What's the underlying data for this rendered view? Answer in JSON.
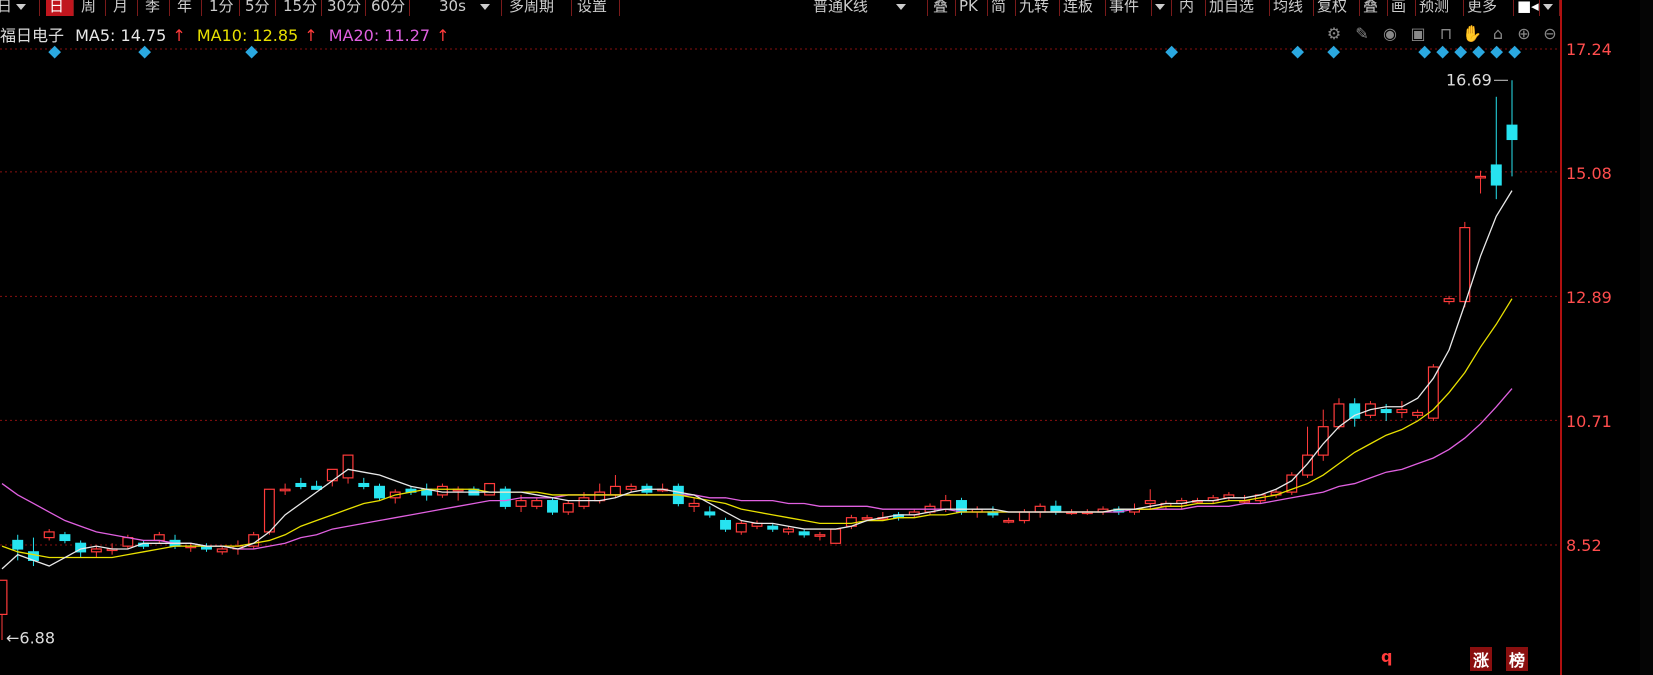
{
  "toolbar": {
    "left_clip": "日",
    "periods": [
      "日",
      "周",
      "月",
      "季",
      "年",
      "1分",
      "5分",
      "15分",
      "30分",
      "60分",
      "30s"
    ],
    "multi": "多周期",
    "settings": "设置",
    "kline_type": "普通K线",
    "right_items": [
      "叠",
      "PK",
      "简",
      "九转",
      "连板",
      "事件",
      "内",
      "加自选",
      "均线",
      "复权",
      "叠",
      "画",
      "预测",
      "更多"
    ]
  },
  "header": {
    "stock_name": "福日电子",
    "ma5": "MA5: 14.75",
    "ma10": "MA10: 12.85",
    "ma20": "MA20: 11.27",
    "arrow": "↑"
  },
  "colors": {
    "up": "#ff3b3b",
    "down": "#27e3f0",
    "ma5": "#e8e8e8",
    "ma10": "#e8e000",
    "ma20": "#e060e0",
    "grid": "#8a1010",
    "event_marker": "#2aa8e0"
  },
  "price_axis": {
    "labels": [
      "17.24",
      "15.08",
      "12.89",
      "10.71",
      "8.52"
    ]
  },
  "annotations": {
    "high": "16.69",
    "low": "6.88"
  },
  "bottom_badges": [
    "q",
    "涨",
    "榜"
  ],
  "chart_data": {
    "type": "candlestick",
    "ylim": [
      6.4,
      18.0
    ],
    "y_ticks": [
      17.24,
      15.08,
      12.89,
      10.71,
      8.52
    ],
    "ohlc": [
      [
        7.3,
        7.9,
        6.85,
        7.9
      ],
      [
        8.6,
        8.7,
        8.25,
        8.45
      ],
      [
        8.4,
        8.65,
        8.15,
        8.25
      ],
      [
        8.65,
        8.8,
        8.6,
        8.75
      ],
      [
        8.7,
        8.75,
        8.55,
        8.6
      ],
      [
        8.55,
        8.6,
        8.3,
        8.4
      ],
      [
        8.4,
        8.5,
        8.3,
        8.45
      ],
      [
        8.45,
        8.55,
        8.35,
        8.45
      ],
      [
        8.5,
        8.7,
        8.45,
        8.65
      ],
      [
        8.55,
        8.6,
        8.45,
        8.5
      ],
      [
        8.6,
        8.75,
        8.55,
        8.7
      ],
      [
        8.6,
        8.7,
        8.45,
        8.5
      ],
      [
        8.5,
        8.55,
        8.4,
        8.5
      ],
      [
        8.5,
        8.55,
        8.4,
        8.45
      ],
      [
        8.4,
        8.5,
        8.35,
        8.45
      ],
      [
        8.45,
        8.6,
        8.35,
        8.5
      ],
      [
        8.5,
        8.75,
        8.45,
        8.7
      ],
      [
        8.75,
        9.5,
        8.7,
        9.5
      ],
      [
        9.5,
        9.6,
        9.4,
        9.5
      ],
      [
        9.6,
        9.7,
        9.5,
        9.55
      ],
      [
        9.55,
        9.65,
        9.5,
        9.5
      ],
      [
        9.65,
        9.85,
        9.55,
        9.85
      ],
      [
        9.7,
        10.1,
        9.6,
        10.1
      ],
      [
        9.6,
        9.7,
        9.5,
        9.55
      ],
      [
        9.55,
        9.6,
        9.3,
        9.35
      ],
      [
        9.35,
        9.5,
        9.25,
        9.45
      ],
      [
        9.5,
        9.55,
        9.4,
        9.45
      ],
      [
        9.5,
        9.6,
        9.3,
        9.4
      ],
      [
        9.4,
        9.6,
        9.35,
        9.55
      ],
      [
        9.5,
        9.55,
        9.3,
        9.5
      ],
      [
        9.5,
        9.55,
        9.4,
        9.4
      ],
      [
        9.4,
        9.6,
        9.4,
        9.6
      ],
      [
        9.5,
        9.55,
        9.15,
        9.2
      ],
      [
        9.2,
        9.4,
        9.1,
        9.3
      ],
      [
        9.2,
        9.35,
        9.15,
        9.3
      ],
      [
        9.3,
        9.35,
        9.05,
        9.1
      ],
      [
        9.1,
        9.3,
        9.05,
        9.25
      ],
      [
        9.2,
        9.45,
        9.15,
        9.35
      ],
      [
        9.3,
        9.6,
        9.25,
        9.45
      ],
      [
        9.4,
        9.75,
        9.35,
        9.55
      ],
      [
        9.5,
        9.6,
        9.45,
        9.55
      ],
      [
        9.55,
        9.6,
        9.4,
        9.45
      ],
      [
        9.5,
        9.6,
        9.45,
        9.5
      ],
      [
        9.55,
        9.6,
        9.2,
        9.25
      ],
      [
        9.2,
        9.35,
        9.1,
        9.25
      ],
      [
        9.1,
        9.2,
        9.0,
        9.05
      ],
      [
        8.95,
        9.0,
        8.75,
        8.8
      ],
      [
        8.75,
        8.95,
        8.7,
        8.9
      ],
      [
        8.85,
        8.95,
        8.8,
        8.9
      ],
      [
        8.85,
        8.9,
        8.75,
        8.8
      ],
      [
        8.75,
        8.85,
        8.7,
        8.8
      ],
      [
        8.75,
        8.8,
        8.65,
        8.7
      ],
      [
        8.7,
        8.75,
        8.6,
        8.7
      ],
      [
        8.55,
        8.8,
        8.55,
        8.8
      ],
      [
        8.85,
        9.05,
        8.8,
        9.0
      ],
      [
        9.0,
        9.05,
        8.95,
        9.0
      ],
      [
        9.0,
        9.1,
        8.95,
        9.0
      ],
      [
        9.05,
        9.1,
        8.95,
        9.0
      ],
      [
        9.05,
        9.15,
        9.0,
        9.1
      ],
      [
        9.1,
        9.25,
        9.05,
        9.2
      ],
      [
        9.15,
        9.4,
        9.1,
        9.3
      ],
      [
        9.3,
        9.35,
        9.05,
        9.1
      ],
      [
        9.1,
        9.2,
        9.0,
        9.15
      ],
      [
        9.1,
        9.2,
        9.0,
        9.05
      ],
      [
        8.95,
        9.0,
        8.9,
        8.95
      ],
      [
        8.95,
        9.15,
        8.9,
        9.1
      ],
      [
        9.1,
        9.25,
        9.0,
        9.2
      ],
      [
        9.2,
        9.3,
        9.05,
        9.1
      ],
      [
        9.1,
        9.15,
        9.05,
        9.1
      ],
      [
        9.1,
        9.15,
        9.05,
        9.1
      ],
      [
        9.1,
        9.2,
        9.05,
        9.15
      ],
      [
        9.15,
        9.2,
        9.05,
        9.1
      ],
      [
        9.1,
        9.25,
        9.05,
        9.15
      ],
      [
        9.25,
        9.5,
        9.15,
        9.3
      ],
      [
        9.2,
        9.3,
        9.15,
        9.25
      ],
      [
        9.25,
        9.35,
        9.15,
        9.3
      ],
      [
        9.3,
        9.35,
        9.25,
        9.3
      ],
      [
        9.3,
        9.4,
        9.25,
        9.35
      ],
      [
        9.35,
        9.45,
        9.3,
        9.4
      ],
      [
        9.3,
        9.4,
        9.25,
        9.3
      ],
      [
        9.3,
        9.4,
        9.25,
        9.4
      ],
      [
        9.4,
        9.5,
        9.35,
        9.45
      ],
      [
        9.45,
        9.8,
        9.4,
        9.75
      ],
      [
        9.75,
        10.6,
        9.7,
        10.1
      ],
      [
        10.1,
        10.9,
        10.0,
        10.6
      ],
      [
        10.6,
        11.1,
        10.55,
        11.0
      ],
      [
        11.0,
        11.1,
        10.6,
        10.75
      ],
      [
        10.8,
        11.05,
        10.75,
        11.0
      ],
      [
        10.9,
        11.0,
        10.7,
        10.85
      ],
      [
        10.85,
        11.05,
        10.75,
        10.9
      ],
      [
        10.8,
        10.9,
        10.75,
        10.85
      ],
      [
        10.75,
        11.7,
        10.7,
        11.65
      ],
      [
        12.8,
        12.9,
        12.75,
        12.85
      ],
      [
        12.8,
        14.2,
        12.7,
        14.1
      ],
      [
        15.0,
        15.1,
        14.7,
        15.0
      ],
      [
        15.2,
        16.4,
        14.6,
        14.85
      ],
      [
        15.9,
        16.69,
        15.0,
        15.65
      ]
    ],
    "ma5": [
      8.1,
      8.35,
      8.25,
      8.15,
      8.3,
      8.45,
      8.5,
      8.45,
      8.45,
      8.55,
      8.55,
      8.55,
      8.55,
      8.5,
      8.5,
      8.45,
      8.55,
      8.75,
      9.05,
      9.25,
      9.45,
      9.65,
      9.85,
      9.8,
      9.75,
      9.65,
      9.55,
      9.5,
      9.45,
      9.45,
      9.45,
      9.45,
      9.45,
      9.45,
      9.4,
      9.35,
      9.3,
      9.3,
      9.3,
      9.35,
      9.45,
      9.5,
      9.5,
      9.45,
      9.4,
      9.25,
      9.1,
      8.95,
      8.9,
      8.9,
      8.85,
      8.8,
      8.8,
      8.8,
      8.85,
      8.95,
      9.0,
      9.05,
      9.05,
      9.1,
      9.15,
      9.15,
      9.15,
      9.15,
      9.1,
      9.1,
      9.1,
      9.1,
      9.1,
      9.1,
      9.1,
      9.15,
      9.15,
      9.2,
      9.25,
      9.25,
      9.3,
      9.3,
      9.35,
      9.35,
      9.4,
      9.5,
      9.65,
      9.95,
      10.3,
      10.6,
      10.8,
      10.9,
      10.95,
      10.95,
      11.1,
      11.45,
      11.95,
      12.75,
      13.6,
      14.3,
      14.75
    ],
    "ma10": [
      8.5,
      8.4,
      8.35,
      8.3,
      8.3,
      8.3,
      8.3,
      8.3,
      8.35,
      8.4,
      8.45,
      8.5,
      8.5,
      8.5,
      8.5,
      8.5,
      8.55,
      8.6,
      8.7,
      8.85,
      8.95,
      9.05,
      9.15,
      9.25,
      9.3,
      9.4,
      9.45,
      9.5,
      9.5,
      9.5,
      9.5,
      9.45,
      9.45,
      9.45,
      9.45,
      9.4,
      9.4,
      9.4,
      9.4,
      9.4,
      9.4,
      9.4,
      9.4,
      9.4,
      9.35,
      9.3,
      9.25,
      9.15,
      9.1,
      9.05,
      9.0,
      8.95,
      8.9,
      8.9,
      8.9,
      8.95,
      8.95,
      9.0,
      9.0,
      9.05,
      9.05,
      9.1,
      9.1,
      9.1,
      9.1,
      9.1,
      9.1,
      9.1,
      9.1,
      9.1,
      9.1,
      9.15,
      9.15,
      9.15,
      9.2,
      9.2,
      9.25,
      9.25,
      9.3,
      9.3,
      9.35,
      9.4,
      9.5,
      9.6,
      9.75,
      9.95,
      10.15,
      10.3,
      10.45,
      10.55,
      10.7,
      10.9,
      11.2,
      11.55,
      12.0,
      12.4,
      12.85
    ],
    "ma20": [
      9.6,
      9.4,
      9.25,
      9.1,
      8.95,
      8.85,
      8.75,
      8.7,
      8.65,
      8.6,
      8.6,
      8.55,
      8.55,
      8.5,
      8.5,
      8.45,
      8.45,
      8.5,
      8.55,
      8.65,
      8.7,
      8.8,
      8.85,
      8.9,
      8.95,
      9.0,
      9.05,
      9.1,
      9.15,
      9.2,
      9.25,
      9.3,
      9.3,
      9.35,
      9.35,
      9.35,
      9.4,
      9.4,
      9.4,
      9.4,
      9.4,
      9.4,
      9.4,
      9.4,
      9.4,
      9.35,
      9.35,
      9.3,
      9.3,
      9.3,
      9.25,
      9.25,
      9.2,
      9.2,
      9.2,
      9.2,
      9.15,
      9.15,
      9.15,
      9.15,
      9.15,
      9.1,
      9.1,
      9.1,
      9.1,
      9.1,
      9.1,
      9.1,
      9.1,
      9.1,
      9.1,
      9.1,
      9.15,
      9.15,
      9.15,
      9.15,
      9.2,
      9.2,
      9.2,
      9.25,
      9.25,
      9.3,
      9.35,
      9.4,
      9.45,
      9.55,
      9.6,
      9.7,
      9.8,
      9.85,
      9.95,
      10.05,
      10.2,
      10.4,
      10.65,
      10.95,
      11.27
    ]
  }
}
